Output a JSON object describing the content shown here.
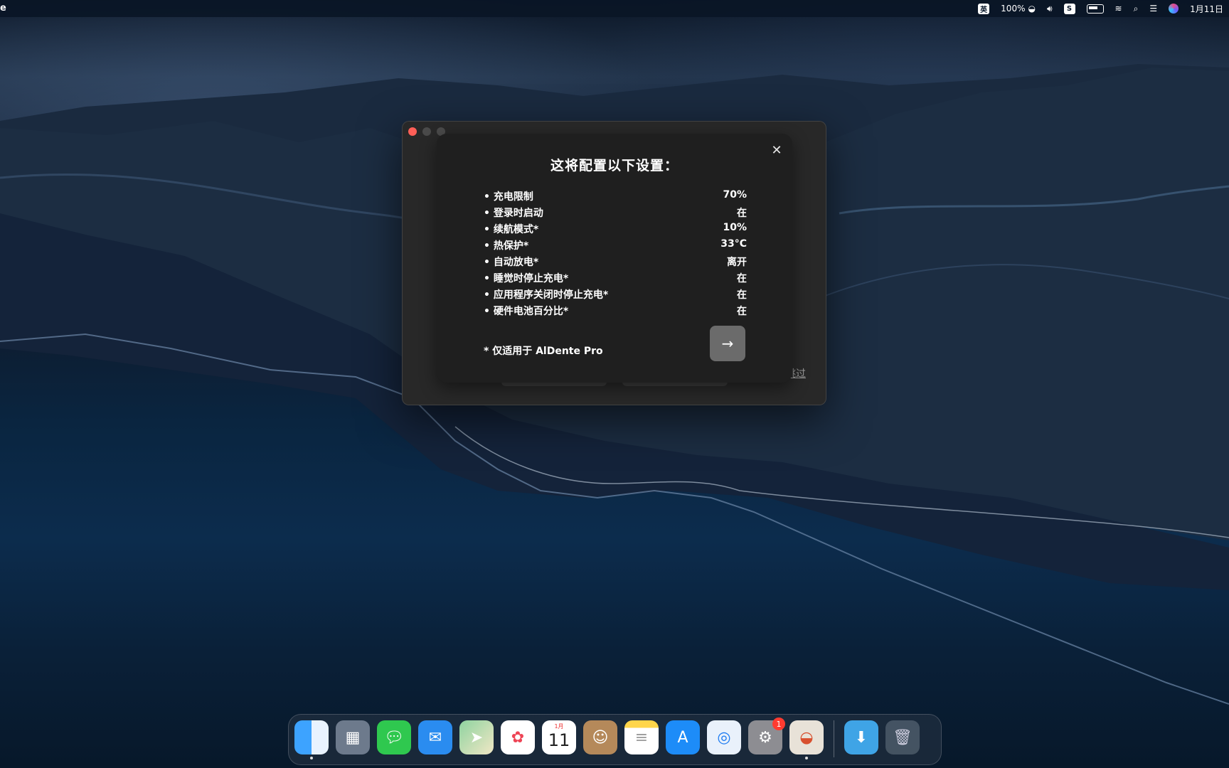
{
  "menubar": {
    "left_fragment": "e",
    "input_method": "英",
    "battery_percent_label": "100%",
    "app_s_icon": "S",
    "date": "1月11日"
  },
  "window": {
    "skip_label": "跳过"
  },
  "sheet": {
    "title": "这将配置以下设置：",
    "rows": [
      {
        "label": "充电限制",
        "value": "70%"
      },
      {
        "label": "登录时启动",
        "value": "在"
      },
      {
        "label": "续航模式*",
        "value": "10%"
      },
      {
        "label": "热保护*",
        "value": "33°C"
      },
      {
        "label": "自动放电*",
        "value": "离开"
      },
      {
        "label": "睡觉时停止充电*",
        "value": "在"
      },
      {
        "label": "应用程序关闭时停止充电*",
        "value": "在"
      },
      {
        "label": "硬件电池百分比*",
        "value": "在"
      }
    ],
    "footnote": "* 仅适用于 AlDente Pro",
    "close_glyph": "✕",
    "next_glyph": "→"
  },
  "dock": {
    "calendar_month": "1月",
    "calendar_day": "11",
    "system_settings_badge": "1"
  },
  "colors": {
    "close": "#fe5f57",
    "sheet_bg": "#1f1f1f",
    "window_bg": "#282828",
    "next_button": "#6b6b6b"
  }
}
